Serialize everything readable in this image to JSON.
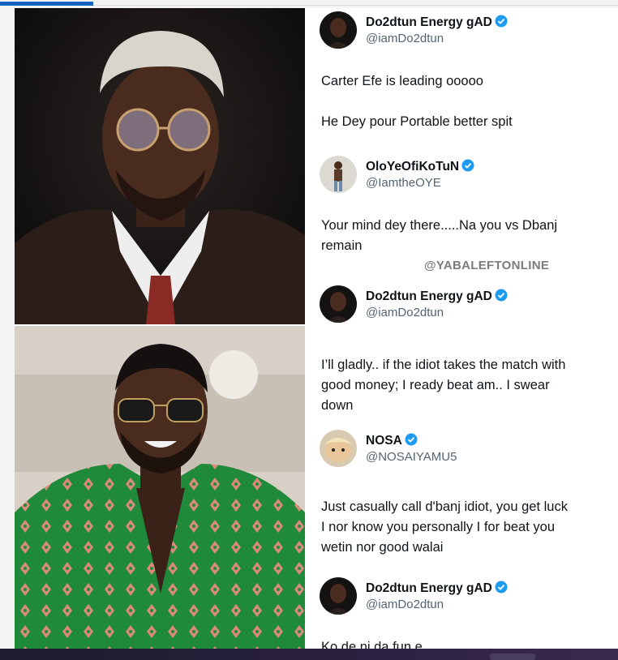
{
  "watermark": "@YABALEFTONLINE",
  "photos": {
    "top_person": "man-with-glasses-photo",
    "bottom_person": "man-in-green-jacket-photo"
  },
  "colors": {
    "verified": "#1d9bf0",
    "accent": "#1565c0",
    "text": "#0f1419",
    "handle": "#536471"
  },
  "tweets": [
    {
      "name": "Do2dtun Energy gAD",
      "handle": "@iamDo2dtun",
      "avatar": "man-dark-avatar",
      "lines": [
        "Carter Efe is leading ooooo",
        "He Dey pour Portable better spit"
      ]
    },
    {
      "name": "OloYeOfiKoTuN",
      "handle": "@IamtheOYE",
      "avatar": "man-standing-avatar",
      "lines": [
        "Your mind dey there.....Na you vs Dbanj",
        "remain"
      ]
    },
    {
      "name": "Do2dtun Energy gAD",
      "handle": "@iamDo2dtun",
      "avatar": "man-dark-avatar",
      "lines": [
        "I’ll gladly.. if the idiot takes the match with",
        "good money; I ready beat am.. I swear",
        "down"
      ]
    },
    {
      "name": "NOSA",
      "handle": "@NOSAIYAMU5",
      "avatar": "cartoon-avatar",
      "lines": [
        "Just casually call d'banj idiot, you get luck",
        "I nor know you personally I for beat you",
        "wetin nor good walai"
      ]
    },
    {
      "name": "Do2dtun Energy gAD",
      "handle": "@iamDo2dtun",
      "avatar": "man-dark-avatar",
      "lines": [
        "Ko de ni da fun e"
      ]
    }
  ]
}
